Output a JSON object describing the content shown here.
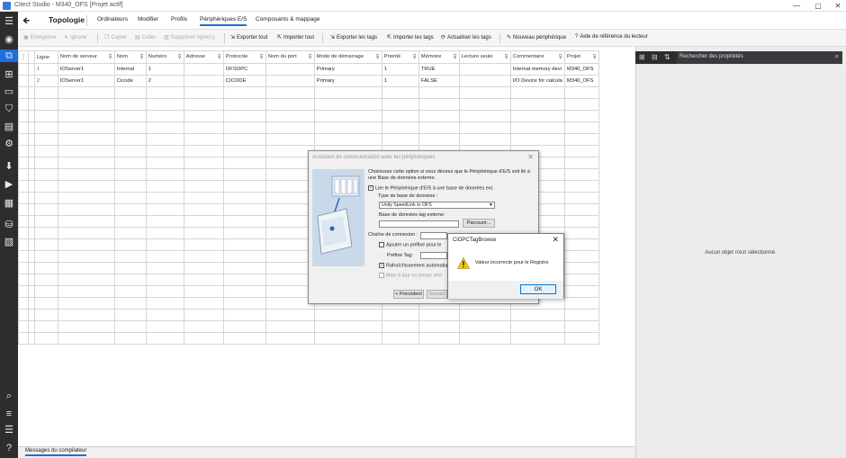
{
  "window": {
    "title": "Citect Studio - M340_OFS [Projet actif]",
    "controls": [
      "—",
      "▢",
      "✕"
    ]
  },
  "nav": {
    "back_icon": "back-arrow-icon",
    "section": "Topologie",
    "tabs": [
      "Ordinateurs",
      "Modifier",
      "Profils",
      "Périphériques E/S",
      "Composants & mappage"
    ],
    "active_tab": "Périphériques E/S"
  },
  "toolbar": {
    "items": [
      {
        "label": "Enregistrer",
        "icon": "▣",
        "disabled": true
      },
      {
        "label": "Ignorer",
        "icon": "✕",
        "disabled": true
      },
      {
        "label": "Copier",
        "icon": "❐",
        "disabled": true
      },
      {
        "label": "Coller",
        "icon": "▤",
        "disabled": true
      },
      {
        "label": "Supprimer ligne(s)",
        "icon": "▥",
        "disabled": true
      },
      {
        "label": "Exporter tout",
        "icon": "⇲",
        "disabled": false
      },
      {
        "label": "Importer tout",
        "icon": "⇱",
        "disabled": false
      },
      {
        "label": "Exporter les tags",
        "icon": "⇲",
        "disabled": false
      },
      {
        "label": "Importer les tags",
        "icon": "⇱",
        "disabled": false
      },
      {
        "label": "Actualiser les tags",
        "icon": "⟳",
        "disabled": false
      },
      {
        "label": "Nouveau périphérique",
        "icon": "✎",
        "disabled": false
      },
      {
        "label": "Aide de référence du lecteur",
        "icon": "?",
        "disabled": false
      }
    ]
  },
  "grid": {
    "columns": [
      "Ligne",
      "Nom de serveur",
      "Nom",
      "Numéro",
      "Adresse",
      "Protocole",
      "Nom du port",
      "Mode de démarrage",
      "Priorité",
      "Mémoire",
      "Lecture seule",
      "Commentaire",
      "Projet"
    ],
    "rows": [
      [
        "1",
        "IOServer1",
        "Internal",
        "1",
        "",
        "OFSOPC",
        "",
        "Primary",
        "1",
        "TRUE",
        "",
        "Internal memory devi",
        "M340_OFS"
      ],
      [
        "2",
        "IOServer1",
        "Cicode",
        "2",
        "",
        "CICODE",
        "",
        "Primary",
        "1",
        "FALSE",
        "",
        "I/O Device for calcula",
        "M340_OFS"
      ]
    ],
    "empty_rows": 22
  },
  "right_panel": {
    "search_placeholder": "Rechercher des propriétés",
    "empty_text": "Aucun objet n'est sélectionné."
  },
  "bottom": {
    "tab": "Messages du compilateur"
  },
  "wizard": {
    "title": "Assistant de communication avec les périphériques",
    "intro": "Choisissez cette option si vous désirez que le Périphérique d'E/S soit lié à une Base de données externe.",
    "link_checkbox": "Lier le Périphérique d'E/S à une base de données ext.",
    "db_type_label": "Type de base de données :",
    "db_type_value": "Unity SpeedLink to OFS",
    "db_ext_label": "Base de données tag externe:",
    "browse_button": "Parcourir...",
    "conn_label": "Chaîne de connexion :",
    "prefix_checkbox": "Ajouter un préfixe pour le",
    "prefix_label": "Préfixe Tag:",
    "refresh_checkbox": "Rafraîchissement automatiqu",
    "realtime_checkbox": "Mise à jour en temps réel",
    "prev_button": "< Précédent",
    "next_button": "Suivant >"
  },
  "alert": {
    "title": "CiOPCTagBrowse",
    "message": "Valeur incorrecte pour le Registre",
    "ok_button": "OK"
  },
  "colors": {
    "accent": "#1e6fd9",
    "rail": "#2d2d30"
  }
}
